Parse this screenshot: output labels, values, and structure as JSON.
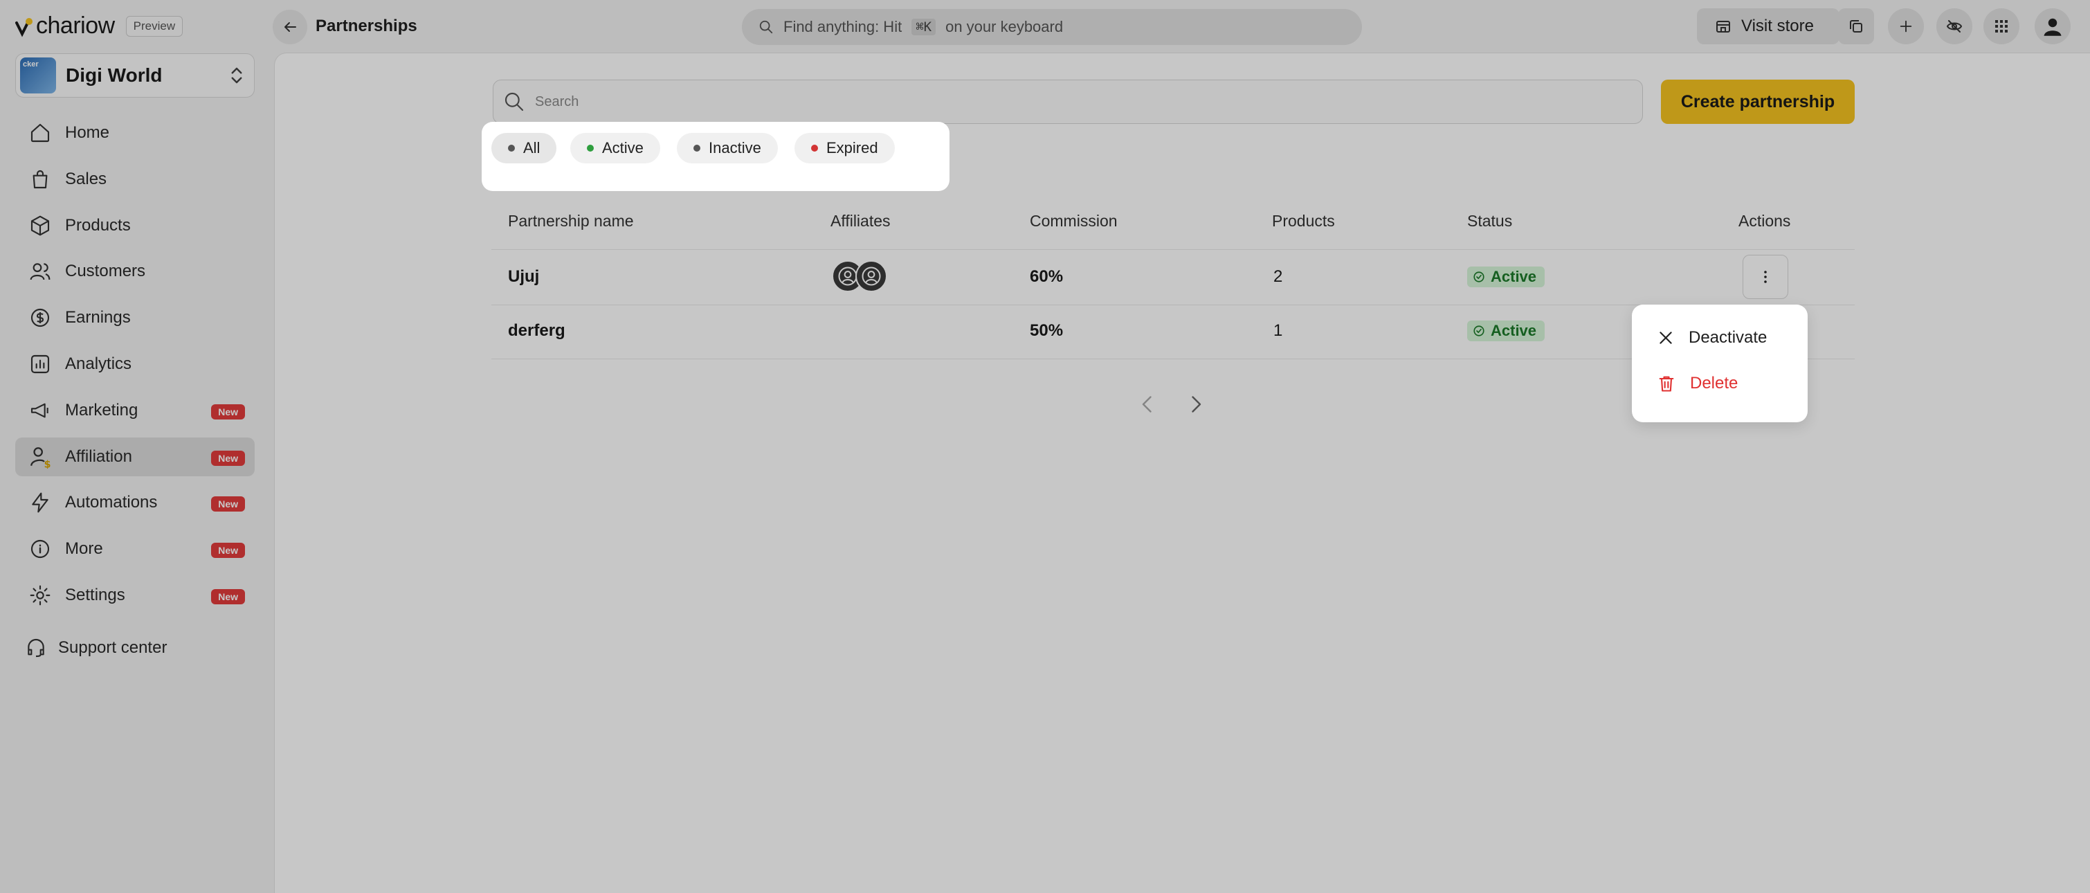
{
  "app": {
    "brand": "chariow",
    "preview_badge": "Preview",
    "page_title": "Partnerships",
    "global_search": {
      "text_before": "Find anything: Hit",
      "shortcut": "⌘K",
      "text_after": "on your keyboard"
    },
    "visit_store_label": "Visit store"
  },
  "store": {
    "name": "Digi World",
    "logo_text": "cker"
  },
  "sidebar": {
    "items": [
      {
        "label": "Home",
        "icon": "home-icon",
        "badge": ""
      },
      {
        "label": "Sales",
        "icon": "shopping-bag-icon",
        "badge": ""
      },
      {
        "label": "Products",
        "icon": "box-icon",
        "badge": ""
      },
      {
        "label": "Customers",
        "icon": "users-icon",
        "badge": ""
      },
      {
        "label": "Earnings",
        "icon": "dollar-coin-icon",
        "badge": ""
      },
      {
        "label": "Analytics",
        "icon": "bar-chart-icon",
        "badge": ""
      },
      {
        "label": "Marketing",
        "icon": "megaphone-icon",
        "badge": "New"
      },
      {
        "label": "Affiliation",
        "icon": "affiliate-user-icon",
        "badge": "New"
      },
      {
        "label": "Automations",
        "icon": "lightning-icon",
        "badge": "New"
      },
      {
        "label": "More",
        "icon": "info-icon",
        "badge": "New"
      },
      {
        "label": "Settings",
        "icon": "gear-icon",
        "badge": "New"
      }
    ],
    "support_label": "Support center"
  },
  "main": {
    "search_placeholder": "Search",
    "create_button_label": "Create partnership",
    "filters": [
      {
        "label": "All",
        "dot_color": "#555555"
      },
      {
        "label": "Active",
        "dot_color": "#2e9e3e"
      },
      {
        "label": "Inactive",
        "dot_color": "#555555"
      },
      {
        "label": "Expired",
        "dot_color": "#d23434"
      }
    ],
    "table": {
      "headers": [
        "Partnership name",
        "Affiliates",
        "Commission",
        "Products",
        "Status",
        "Actions"
      ],
      "rows": [
        {
          "name": "Ujuj",
          "affiliates": 2,
          "commission": "60%",
          "products": "2",
          "status": "Active"
        },
        {
          "name": "derferg",
          "affiliates": 0,
          "commission": "50%",
          "products": "1",
          "status": "Active"
        }
      ]
    },
    "row_menu": {
      "deactivate_label": "Deactivate",
      "delete_label": "Delete"
    }
  },
  "colors": {
    "accent": "#f5c320",
    "status_active_bg": "#d7f5d9",
    "status_active_text": "#1b7a2a",
    "delete_red": "#e03131",
    "badge_new": "#e23b3b"
  }
}
